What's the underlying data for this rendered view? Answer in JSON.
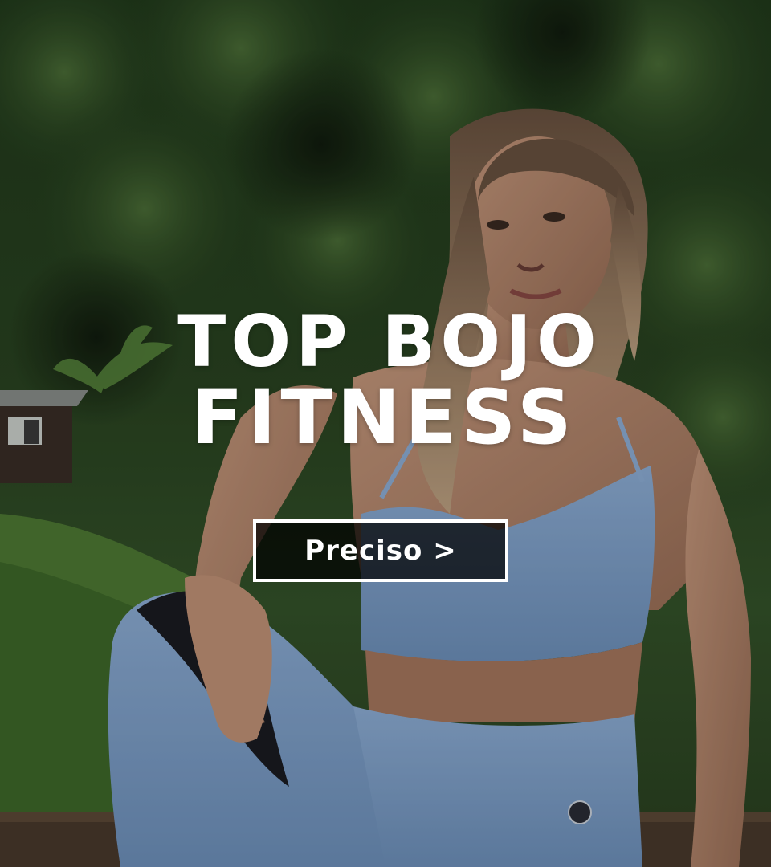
{
  "banner": {
    "headline_line1": "TOP BOJO",
    "headline_line2": "FITNESS",
    "cta_label": "Preciso >"
  },
  "colors": {
    "text": "#ffffff",
    "foliage_dark": "#1c2e18",
    "foliage_mid": "#2f4a26",
    "outfit_blue": "#8fb0d8",
    "button_bg": "#111111"
  },
  "icons": {
    "cta_arrow": ">"
  }
}
